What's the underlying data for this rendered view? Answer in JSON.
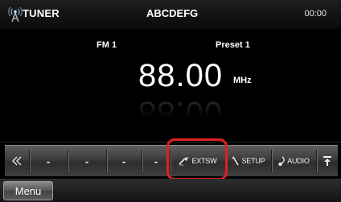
{
  "status_bar": {
    "source_label": "TUNER",
    "station_name": "ABCDEFG",
    "clock": "00:00"
  },
  "tuner": {
    "band": "FM 1",
    "preset": "Preset 1",
    "frequency": "88.00",
    "unit": "MHz"
  },
  "function_bar": {
    "prev_icon": "double-left-chevron-icon",
    "slots": [
      "-",
      "-",
      "-",
      "-"
    ],
    "extsw_label": "EXTSW",
    "setup_label": "SETUP",
    "audio_label": "AUDIO",
    "eject_icon": "eject-up-icon"
  },
  "menu": {
    "label": "Menu"
  },
  "colors": {
    "highlight": "#e02020",
    "background": "#000000"
  }
}
